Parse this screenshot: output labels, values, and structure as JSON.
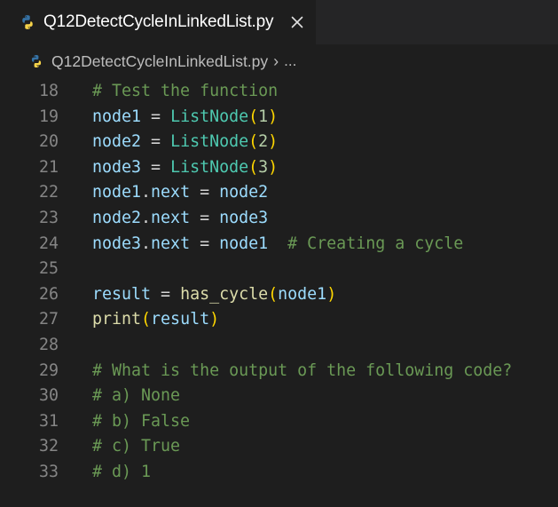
{
  "tab": {
    "title": "Q12DetectCycleInLinkedList.py",
    "close_glyph": "✕"
  },
  "breadcrumb": {
    "file": "Q12DetectCycleInLinkedList.py",
    "chevron": "›",
    "more": "..."
  },
  "colors": {
    "python_blue": "#3572a5",
    "python_yellow": "#f7d44a",
    "background": "#1e1e1e",
    "comment": "#6a9955",
    "variable": "#9cdcfe",
    "class": "#4ec9b0",
    "function": "#dcdcaa"
  },
  "lines": [
    {
      "n": "18",
      "tokens": [
        {
          "t": "# Test the function",
          "k": "cmt"
        }
      ]
    },
    {
      "n": "19",
      "tokens": [
        {
          "t": "node1",
          "k": "var"
        },
        {
          "t": " = ",
          "k": "op"
        },
        {
          "t": "ListNode",
          "k": "cls"
        },
        {
          "t": "(",
          "k": "br1"
        },
        {
          "t": "1",
          "k": "num"
        },
        {
          "t": ")",
          "k": "br1"
        }
      ]
    },
    {
      "n": "20",
      "tokens": [
        {
          "t": "node2",
          "k": "var"
        },
        {
          "t": " = ",
          "k": "op"
        },
        {
          "t": "ListNode",
          "k": "cls"
        },
        {
          "t": "(",
          "k": "br1"
        },
        {
          "t": "2",
          "k": "num"
        },
        {
          "t": ")",
          "k": "br1"
        }
      ]
    },
    {
      "n": "21",
      "tokens": [
        {
          "t": "node3",
          "k": "var"
        },
        {
          "t": " = ",
          "k": "op"
        },
        {
          "t": "ListNode",
          "k": "cls"
        },
        {
          "t": "(",
          "k": "br1"
        },
        {
          "t": "3",
          "k": "num"
        },
        {
          "t": ")",
          "k": "br1"
        }
      ]
    },
    {
      "n": "22",
      "tokens": [
        {
          "t": "node1",
          "k": "var"
        },
        {
          "t": ".",
          "k": "punc"
        },
        {
          "t": "next",
          "k": "var"
        },
        {
          "t": " = ",
          "k": "op"
        },
        {
          "t": "node2",
          "k": "var"
        }
      ]
    },
    {
      "n": "23",
      "tokens": [
        {
          "t": "node2",
          "k": "var"
        },
        {
          "t": ".",
          "k": "punc"
        },
        {
          "t": "next",
          "k": "var"
        },
        {
          "t": " = ",
          "k": "op"
        },
        {
          "t": "node3",
          "k": "var"
        }
      ]
    },
    {
      "n": "24",
      "tokens": [
        {
          "t": "node3",
          "k": "var"
        },
        {
          "t": ".",
          "k": "punc"
        },
        {
          "t": "next",
          "k": "var"
        },
        {
          "t": " = ",
          "k": "op"
        },
        {
          "t": "node1",
          "k": "var"
        },
        {
          "t": "  ",
          "k": "op"
        },
        {
          "t": "# Creating a cycle",
          "k": "cmt"
        }
      ]
    },
    {
      "n": "25",
      "tokens": []
    },
    {
      "n": "26",
      "tokens": [
        {
          "t": "result",
          "k": "var"
        },
        {
          "t": " = ",
          "k": "op"
        },
        {
          "t": "has_cycle",
          "k": "fn"
        },
        {
          "t": "(",
          "k": "br1"
        },
        {
          "t": "node1",
          "k": "var"
        },
        {
          "t": ")",
          "k": "br1"
        }
      ]
    },
    {
      "n": "27",
      "tokens": [
        {
          "t": "print",
          "k": "fn"
        },
        {
          "t": "(",
          "k": "br1"
        },
        {
          "t": "result",
          "k": "var"
        },
        {
          "t": ")",
          "k": "br1"
        }
      ]
    },
    {
      "n": "28",
      "tokens": []
    },
    {
      "n": "29",
      "tokens": [
        {
          "t": "# What is the output of the following code?",
          "k": "cmt"
        }
      ]
    },
    {
      "n": "30",
      "tokens": [
        {
          "t": "# a) None",
          "k": "cmt"
        }
      ]
    },
    {
      "n": "31",
      "tokens": [
        {
          "t": "# b) False",
          "k": "cmt"
        }
      ]
    },
    {
      "n": "32",
      "tokens": [
        {
          "t": "# c) True",
          "k": "cmt"
        }
      ]
    },
    {
      "n": "33",
      "tokens": [
        {
          "t": "# d) 1",
          "k": "cmt"
        }
      ]
    }
  ]
}
